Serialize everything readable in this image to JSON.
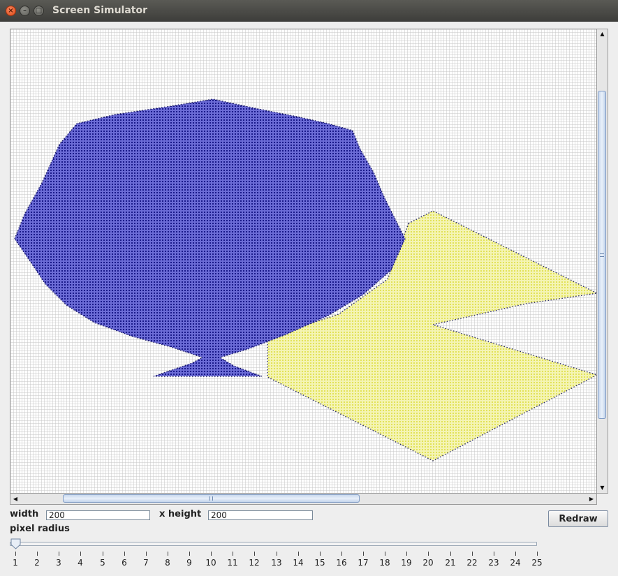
{
  "window": {
    "title": "Screen Simulator",
    "buttons": [
      "close-icon",
      "minimize-icon",
      "maximize-icon"
    ]
  },
  "canvas": {
    "grid_color": "#c9c9c9",
    "background": "#ffffff",
    "shapes": [
      {
        "name": "blob",
        "fill": "#2a2ac8",
        "dot_color": "#1c1c7a"
      },
      {
        "name": "polygon",
        "fill": "#eeee8a",
        "dot_color": "#2a2a6a"
      }
    ]
  },
  "controls": {
    "width_label": "width",
    "width_value": "200",
    "height_label": "x height",
    "height_value": "200",
    "redraw_label": "Redraw",
    "pixel_radius_label": "pixel radius",
    "slider_value": 1,
    "slider_min": 1,
    "slider_max": 25,
    "ticks": [
      "1",
      "2",
      "3",
      "4",
      "5",
      "6",
      "7",
      "8",
      "9",
      "10",
      "11",
      "12",
      "13",
      "14",
      "15",
      "16",
      "17",
      "18",
      "19",
      "20",
      "21",
      "22",
      "23",
      "24",
      "25"
    ]
  },
  "scroll": {
    "up_icon": "▲",
    "down_icon": "▼",
    "left_icon": "◀",
    "right_icon": "▶"
  }
}
